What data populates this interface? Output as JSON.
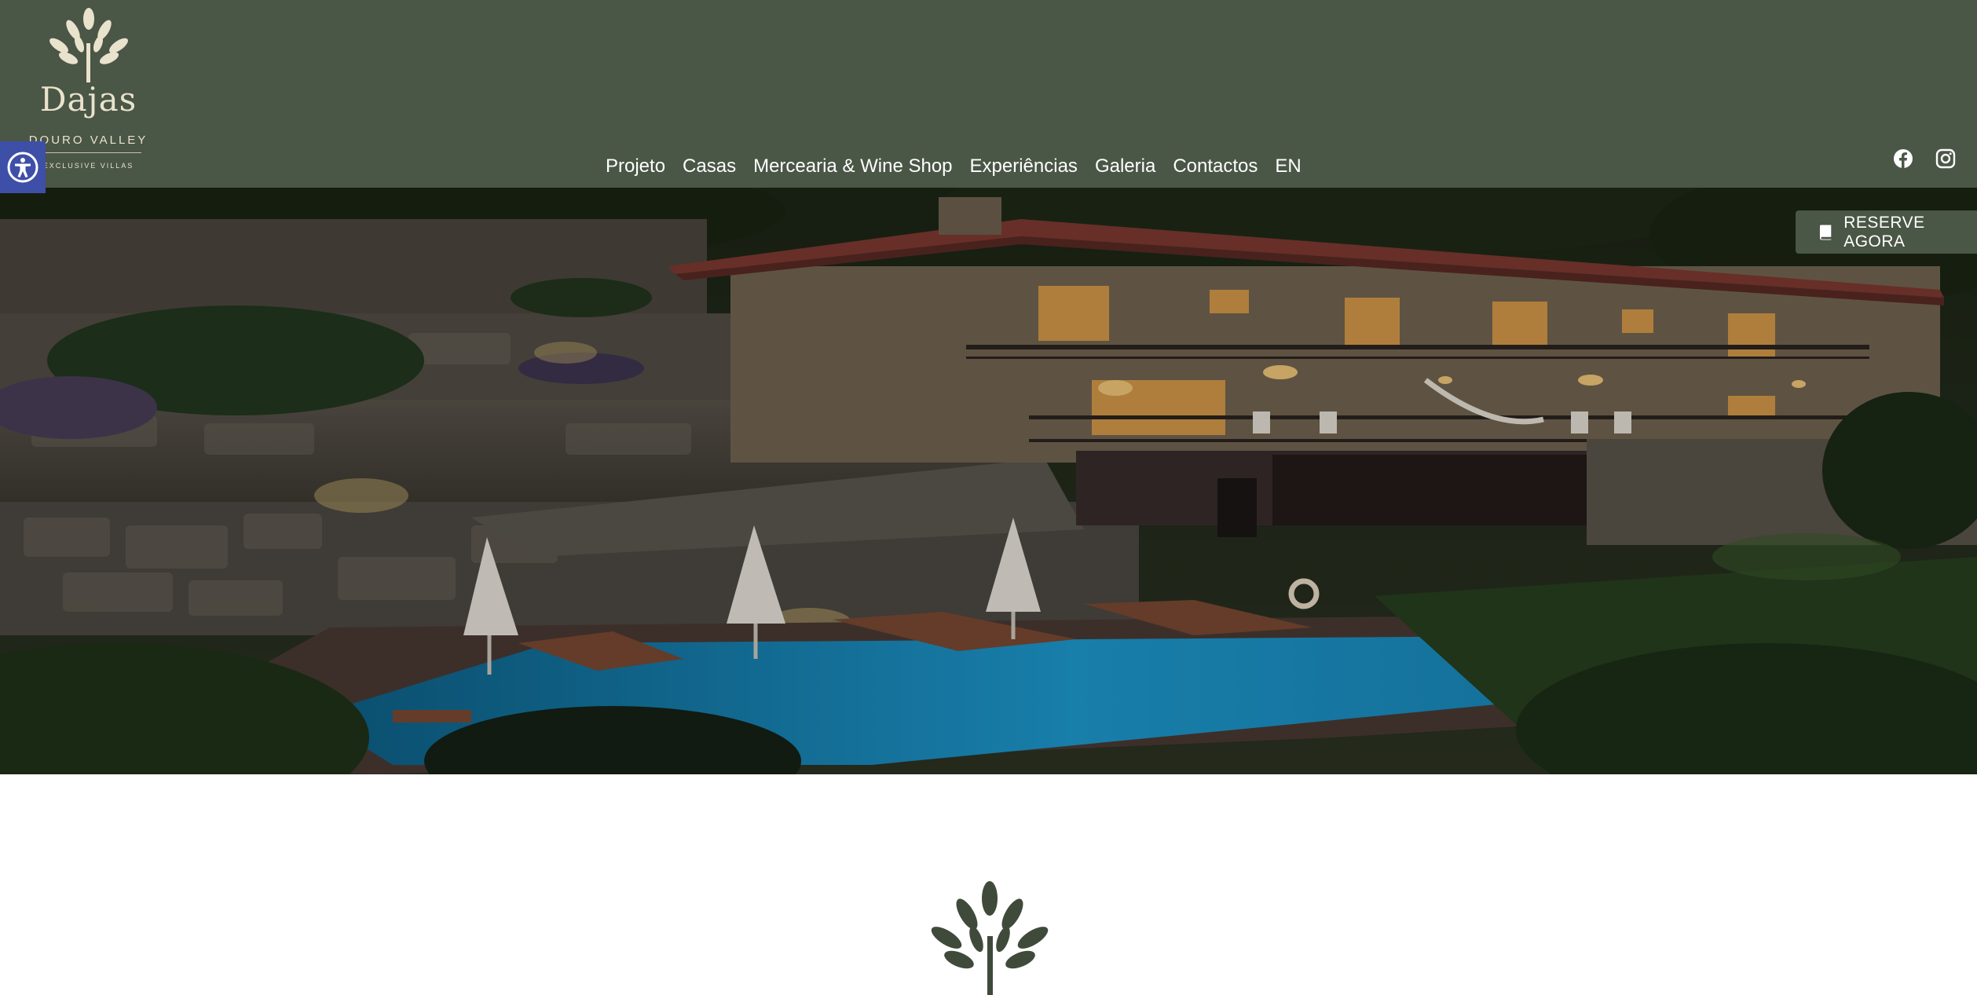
{
  "logo": {
    "name": "Dajas",
    "subtitle": "DOURO VALLEY",
    "tagline": "EXCLUSIVE VILLAS",
    "color": "#e9e2cc"
  },
  "accessibility": {
    "icon": "accessibility-icon",
    "color": "#3e4fa8"
  },
  "nav": {
    "items": [
      {
        "label": "Projeto"
      },
      {
        "label": "Casas"
      },
      {
        "label": "Mercearia & Wine Shop"
      },
      {
        "label": "Experiências"
      },
      {
        "label": "Galeria"
      },
      {
        "label": "Contactos"
      },
      {
        "label": "EN"
      }
    ]
  },
  "social": {
    "facebook_icon": "facebook-icon",
    "instagram_icon": "instagram-icon"
  },
  "reserve": {
    "label": "RESERVE AGORA",
    "icon": "book-icon"
  },
  "hero": {
    "description_icon": "villa-pool-night-photo"
  },
  "colors": {
    "header_bg": "#4a5646",
    "accent": "#4a5646",
    "pool": "#1e9ad0"
  }
}
